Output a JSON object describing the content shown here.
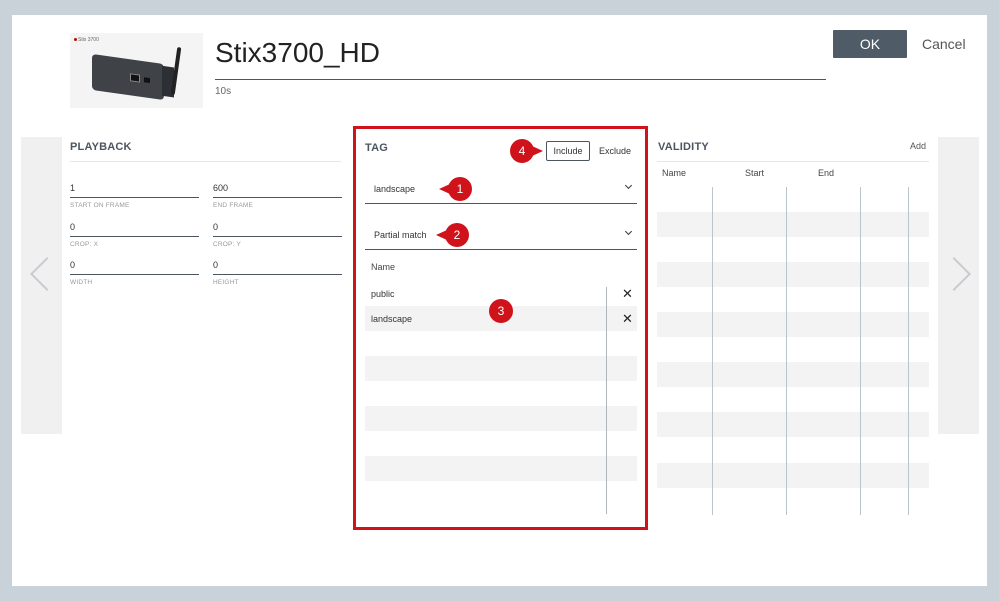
{
  "header": {
    "title": "Stix3700_HD",
    "duration": "10s",
    "thumbnail_label": "Stix 3700",
    "ok_label": "OK",
    "cancel_label": "Cancel"
  },
  "playback": {
    "section_title": "PLAYBACK",
    "fields": [
      {
        "value": "1",
        "label": "START ON FRAME"
      },
      {
        "value": "600",
        "label": "END FRAME"
      },
      {
        "value": "0",
        "label": "CROP: X"
      },
      {
        "value": "0",
        "label": "CROP: Y"
      },
      {
        "value": "0",
        "label": "WIDTH"
      },
      {
        "value": "0",
        "label": "HEIGHT"
      }
    ]
  },
  "tag": {
    "section_title": "TAG",
    "include_label": "Include",
    "exclude_label": "Exclude",
    "tag_select_value": "landscape",
    "match_select_value": "Partial match",
    "list_header": "Name",
    "items": [
      "public",
      "landscape"
    ]
  },
  "validity": {
    "section_title": "VALIDITY",
    "add_label": "Add",
    "columns": [
      "Name",
      "Start",
      "End"
    ]
  },
  "callouts": [
    "1",
    "2",
    "3",
    "4"
  ],
  "colors": {
    "highlight_border": "#d0121b",
    "ok_button": "#4f5b66",
    "backdrop": "#c9d1d9"
  }
}
